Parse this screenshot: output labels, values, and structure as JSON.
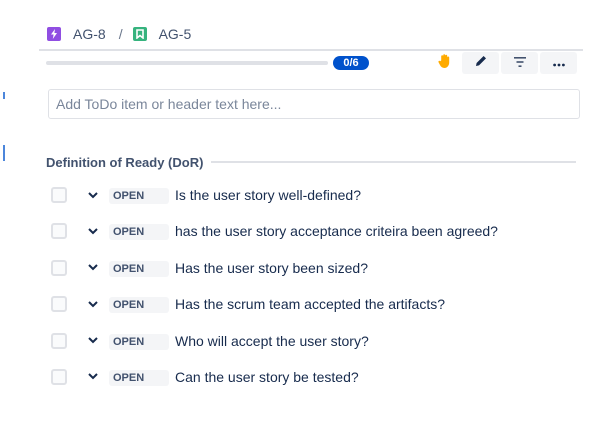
{
  "breadcrumb": {
    "items": [
      {
        "label": "AG-8",
        "icon": "epic-lightning-icon",
        "color": "#904ee2"
      },
      {
        "label": "AG-5",
        "icon": "story-bookmark-icon",
        "color": "#36b37e"
      }
    ],
    "separator": "/"
  },
  "progress": {
    "completed": 0,
    "total": 6,
    "fraction": 0,
    "label": "0/6",
    "color": "#0052cc"
  },
  "toolbar": {
    "buttons": [
      {
        "name": "raise-hand-icon",
        "color": "#ffab00"
      },
      {
        "name": "edit-pencil-icon",
        "color": "#42526e"
      },
      {
        "name": "filter-icon",
        "color": "#42526e"
      },
      {
        "name": "more-options-icon",
        "color": "#42526e"
      }
    ]
  },
  "input": {
    "placeholder": "Add ToDo item or header text here...",
    "value": ""
  },
  "section": {
    "title": "Definition of Ready (DoR)"
  },
  "items": [
    {
      "status": "OPEN",
      "text": "Is the user story well-defined?"
    },
    {
      "status": "OPEN",
      "text": "has the user story acceptance criteira been agreed?"
    },
    {
      "status": "OPEN",
      "text": "Has the user story been sized?"
    },
    {
      "status": "OPEN",
      "text": "Has the scrum team accepted the artifacts?"
    },
    {
      "status": "OPEN",
      "text": "Who will accept the user story?"
    },
    {
      "status": "OPEN",
      "text": "Can the user story be tested?"
    }
  ]
}
